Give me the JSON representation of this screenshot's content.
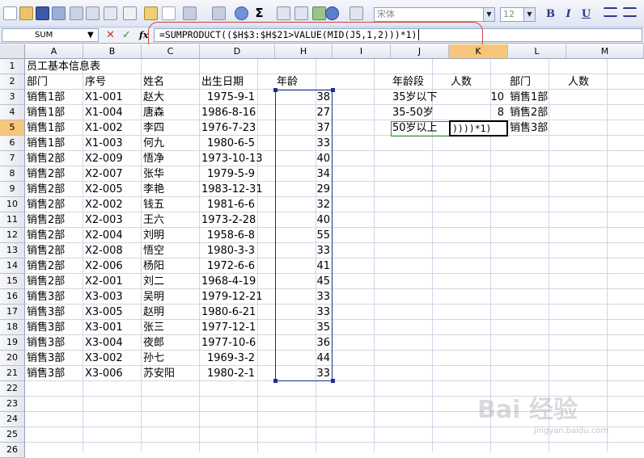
{
  "formula_bar": {
    "name_box": "SUM",
    "cancel_glyph": "✕",
    "enter_glyph": "✓",
    "fx_label": "fx",
    "formula": "=SUMPRODUCT(($H$3:$H$21>VALUE(MID(J5,1,2)))*1)"
  },
  "toolbar": {
    "font_name": "宋体",
    "font_size": "12",
    "bold": "B",
    "italic": "I",
    "underline": "U",
    "sum_glyph": "Σ"
  },
  "columns": [
    "A",
    "B",
    "C",
    "D",
    "H",
    "I",
    "J",
    "K",
    "L",
    "M"
  ],
  "rows": [
    "1",
    "2",
    "3",
    "4",
    "5",
    "6",
    "7",
    "8",
    "9",
    "10",
    "11",
    "12",
    "13",
    "14",
    "15",
    "16",
    "17",
    "18",
    "19",
    "20",
    "21",
    "22",
    "23",
    "24",
    "25",
    "26"
  ],
  "sheet": {
    "title": "员工基本信息表",
    "headers": {
      "dept": "部门",
      "seq": "序号",
      "name": "姓名",
      "birth": "出生日期",
      "age": "年龄"
    },
    "records": [
      [
        "销售1部",
        "X1-001",
        "赵大",
        "1975-9-1",
        "38"
      ],
      [
        "销售1部",
        "X1-004",
        "唐森",
        "1986-8-16",
        "27"
      ],
      [
        "销售1部",
        "X1-002",
        "李四",
        "1976-7-23",
        "37"
      ],
      [
        "销售1部",
        "X1-003",
        "何九",
        "1980-6-5",
        "33"
      ],
      [
        "销售2部",
        "X2-009",
        "悟净",
        "1973-10-13",
        "40"
      ],
      [
        "销售2部",
        "X2-007",
        "张华",
        "1979-5-9",
        "34"
      ],
      [
        "销售2部",
        "X2-005",
        "李艳",
        "1983-12-31",
        "29"
      ],
      [
        "销售2部",
        "X2-002",
        "钱五",
        "1981-6-6",
        "32"
      ],
      [
        "销售2部",
        "X2-003",
        "王六",
        "1973-2-28",
        "40"
      ],
      [
        "销售2部",
        "X2-004",
        "刘明",
        "1958-6-8",
        "55"
      ],
      [
        "销售2部",
        "X2-008",
        "悟空",
        "1980-3-3",
        "33"
      ],
      [
        "销售2部",
        "X2-006",
        "杨阳",
        "1972-6-6",
        "41"
      ],
      [
        "销售2部",
        "X2-001",
        "刘二",
        "1968-4-19",
        "45"
      ],
      [
        "销售3部",
        "X3-003",
        "吴明",
        "1979-12-21",
        "33"
      ],
      [
        "销售3部",
        "X3-005",
        "赵明",
        "1980-6-21",
        "33"
      ],
      [
        "销售3部",
        "X3-001",
        "张三",
        "1977-12-1",
        "35"
      ],
      [
        "销售3部",
        "X3-004",
        "夜郎",
        "1977-10-6",
        "36"
      ],
      [
        "销售3部",
        "X3-002",
        "孙七",
        "1969-3-2",
        "44"
      ],
      [
        "销售3部",
        "X3-006",
        "苏安阳",
        "1980-2-1",
        "33"
      ]
    ],
    "summary_headers": {
      "age_group": "年龄段",
      "count": "人数",
      "dept": "部门",
      "count2": "人数"
    },
    "summary": [
      {
        "group": "35岁以下",
        "count": "10",
        "dept": "销售1部"
      },
      {
        "group": "35-50岁",
        "count": "8",
        "dept": "销售2部"
      },
      {
        "group": "50岁以上",
        "count": "))))*1)",
        "dept": "销售3部"
      }
    ]
  },
  "watermark": "Bai 经验",
  "watermark_url": "jingyan.baidu.com"
}
